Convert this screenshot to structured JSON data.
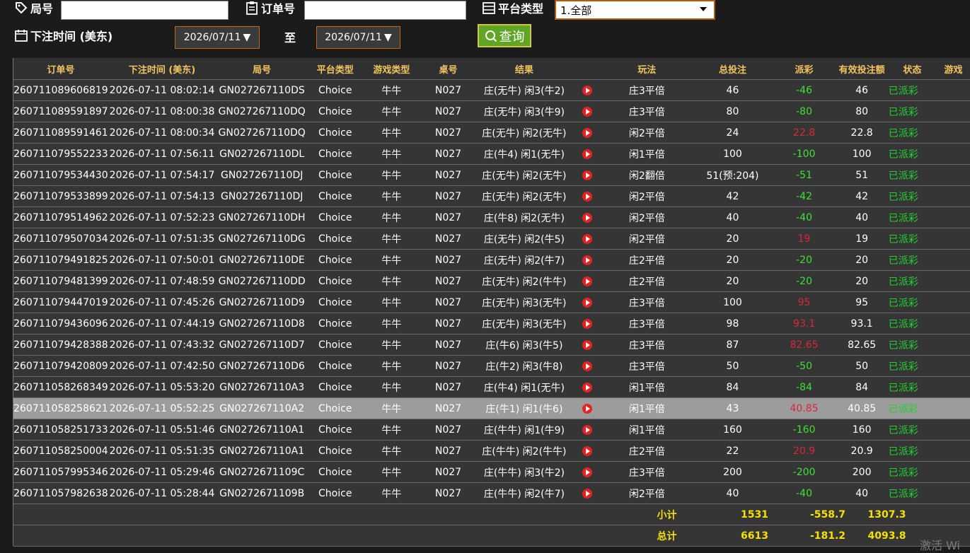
{
  "filters": {
    "round_label": "局号",
    "round_value": "",
    "order_label": "订单号",
    "order_value": "",
    "platform_label": "平台类型",
    "platform_selected": "1.全部",
    "time_label": "下注时间 (美东)",
    "date_from": "2026/07/11",
    "to_label": "至",
    "date_to": "2026/07/11",
    "query_label": "查询"
  },
  "table": {
    "headers": [
      "订单号",
      "下注时间 (美东)",
      "局号",
      "平台类型",
      "游戏类型",
      "桌号",
      "结果",
      "",
      "玩法",
      "总投注",
      "派彩",
      "有效投注额",
      "状态",
      "游戏"
    ],
    "rows": [
      [
        "260711089606819",
        "2026-07-11 08:02:14",
        "GN027267110DS",
        "Choice",
        "牛牛",
        "N027",
        "庄(无牛) 闲3(牛2)",
        "",
        "庄3平倍",
        "46",
        "-46",
        "46",
        "已派彩"
      ],
      [
        "260711089591897",
        "2026-07-11 08:00:38",
        "GN027267110DQ",
        "Choice",
        "牛牛",
        "N027",
        "庄(无牛) 闲3(牛9)",
        "",
        "庄3平倍",
        "80",
        "-80",
        "80",
        "已派彩"
      ],
      [
        "260711089591461",
        "2026-07-11 08:00:34",
        "GN027267110DQ",
        "Choice",
        "牛牛",
        "N027",
        "庄(无牛) 闲2(无牛)",
        "",
        "闲2平倍",
        "24",
        "22.8",
        "22.8",
        "已派彩"
      ],
      [
        "260711079552233",
        "2026-07-11 07:56:11",
        "GN027267110DL",
        "Choice",
        "牛牛",
        "N027",
        "庄(牛4) 闲1(无牛)",
        "",
        "闲1平倍",
        "100",
        "-100",
        "100",
        "已派彩"
      ],
      [
        "260711079534430",
        "2026-07-11 07:54:17",
        "GN027267110DJ",
        "Choice",
        "牛牛",
        "N027",
        "庄(无牛) 闲2(无牛)",
        "",
        "闲2翻倍",
        "51(预:204)",
        "-51",
        "51",
        "已派彩"
      ],
      [
        "260711079533899",
        "2026-07-11 07:54:13",
        "GN027267110DJ",
        "Choice",
        "牛牛",
        "N027",
        "庄(无牛) 闲2(无牛)",
        "",
        "闲2平倍",
        "42",
        "-42",
        "42",
        "已派彩"
      ],
      [
        "260711079514962",
        "2026-07-11 07:52:23",
        "GN027267110DH",
        "Choice",
        "牛牛",
        "N027",
        "庄(牛8) 闲2(无牛)",
        "",
        "闲2平倍",
        "40",
        "-40",
        "40",
        "已派彩"
      ],
      [
        "260711079507034",
        "2026-07-11 07:51:35",
        "GN027267110DG",
        "Choice",
        "牛牛",
        "N027",
        "庄(无牛) 闲2(牛5)",
        "",
        "闲2平倍",
        "20",
        "19",
        "19",
        "已派彩"
      ],
      [
        "260711079491825",
        "2026-07-11 07:50:01",
        "GN027267110DE",
        "Choice",
        "牛牛",
        "N027",
        "庄(无牛) 闲2(牛7)",
        "",
        "庄2平倍",
        "20",
        "-20",
        "20",
        "已派彩"
      ],
      [
        "260711079481399",
        "2026-07-11 07:48:59",
        "GN027267110DD",
        "Choice",
        "牛牛",
        "N027",
        "庄(无牛) 闲2(牛牛)",
        "",
        "庄2平倍",
        "20",
        "-20",
        "20",
        "已派彩"
      ],
      [
        "260711079447019",
        "2026-07-11 07:45:26",
        "GN027267110D9",
        "Choice",
        "牛牛",
        "N027",
        "庄(无牛) 闲3(无牛)",
        "",
        "庄3平倍",
        "100",
        "95",
        "95",
        "已派彩"
      ],
      [
        "260711079436096",
        "2026-07-11 07:44:19",
        "GN027267110D8",
        "Choice",
        "牛牛",
        "N027",
        "庄(无牛) 闲3(无牛)",
        "",
        "庄3平倍",
        "98",
        "93.1",
        "93.1",
        "已派彩"
      ],
      [
        "260711079428388",
        "2026-07-11 07:43:32",
        "GN027267110D7",
        "Choice",
        "牛牛",
        "N027",
        "庄(牛6) 闲3(牛5)",
        "",
        "庄3平倍",
        "87",
        "82.65",
        "82.65",
        "已派彩"
      ],
      [
        "260711079420809",
        "2026-07-11 07:42:50",
        "GN027267110D6",
        "Choice",
        "牛牛",
        "N027",
        "庄(牛2) 闲3(牛8)",
        "",
        "庄3平倍",
        "50",
        "-50",
        "50",
        "已派彩"
      ],
      [
        "260711058268349",
        "2026-07-11 05:53:20",
        "GN027267110A3",
        "Choice",
        "牛牛",
        "N027",
        "庄(牛4) 闲1(无牛)",
        "",
        "闲1平倍",
        "84",
        "-84",
        "84",
        "已派彩"
      ],
      [
        "260711058258621",
        "2026-07-11 05:52:25",
        "GN027267110A2",
        "Choice",
        "牛牛",
        "N027",
        "庄(牛1) 闲1(牛6)",
        "",
        "闲1平倍",
        "43",
        "40.85",
        "40.85",
        "已派彩"
      ],
      [
        "260711058251733",
        "2026-07-11 05:51:46",
        "GN027267110A1",
        "Choice",
        "牛牛",
        "N027",
        "庄(牛牛) 闲1(牛9)",
        "",
        "闲1平倍",
        "160",
        "-160",
        "160",
        "已派彩"
      ],
      [
        "260711058250004",
        "2026-07-11 05:51:35",
        "GN027267110A1",
        "Choice",
        "牛牛",
        "N027",
        "庄(牛牛) 闲2(牛牛)",
        "",
        "庄2平倍",
        "22",
        "20.9",
        "20.9",
        "已派彩"
      ],
      [
        "260711057995346",
        "2026-07-11 05:29:46",
        "GN0272671109C",
        "Choice",
        "牛牛",
        "N027",
        "庄(牛牛) 闲3(牛2)",
        "",
        "庄3平倍",
        "200",
        "-200",
        "200",
        "已派彩"
      ],
      [
        "260711057982638",
        "2026-07-11 05:28:44",
        "GN0272671109B",
        "Choice",
        "牛牛",
        "N027",
        "庄(牛牛) 闲2(牛7)",
        "",
        "闲2平倍",
        "40",
        "-40",
        "40",
        "已派彩"
      ]
    ],
    "subtotal": {
      "label": "小计",
      "total_bet": "1531",
      "payout": "-558.7",
      "valid_bet": "1307.3"
    },
    "grandtotal": {
      "label": "总计",
      "total_bet": "6613",
      "payout": "-181.2",
      "valid_bet": "4093.8"
    },
    "highlighted_row": 15
  },
  "watermark": "激活 Wi",
  "colors": {
    "header_text": "#f2c460",
    "negative": "#3fe035",
    "positive": "#d8283a",
    "status": "#22d030",
    "summary": "#f5e000",
    "query_button": "#5fa624"
  }
}
